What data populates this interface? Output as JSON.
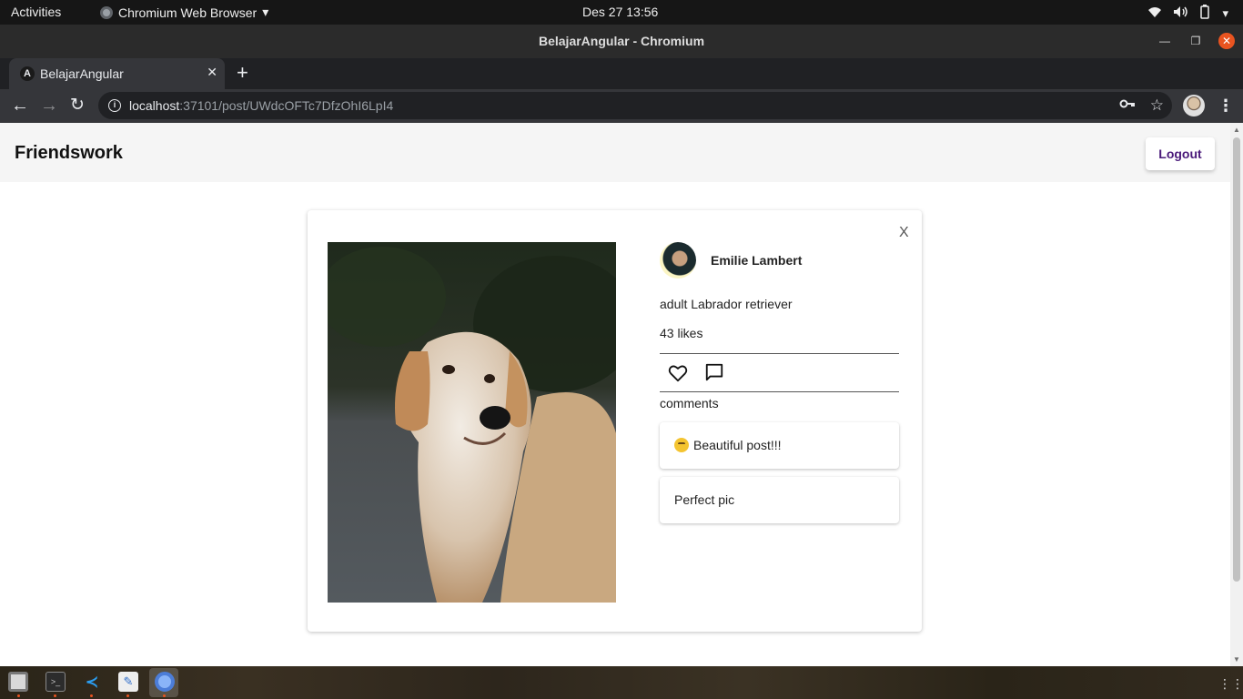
{
  "system_bar": {
    "activities": "Activities",
    "app_name": "Chromium Web Browser",
    "datetime": "Des 27  13:56"
  },
  "window": {
    "title": "BelajarAngular - Chromium"
  },
  "browser": {
    "tab_title": "BelajarAngular",
    "url_host": "localhost",
    "url_path": ":37101/post/UWdcOFTc7DfzOhI6LpI4"
  },
  "app": {
    "brand": "Friendswork",
    "logout_label": "Logout"
  },
  "post": {
    "close_label": "X",
    "author_name": "Emilie Lambert",
    "caption": "adult Labrador retriever",
    "likes_text": "43 likes",
    "comments_label": "comments",
    "comments": [
      {
        "text": "Beautiful post!!!"
      },
      {
        "text": "Perfect pic"
      }
    ]
  }
}
